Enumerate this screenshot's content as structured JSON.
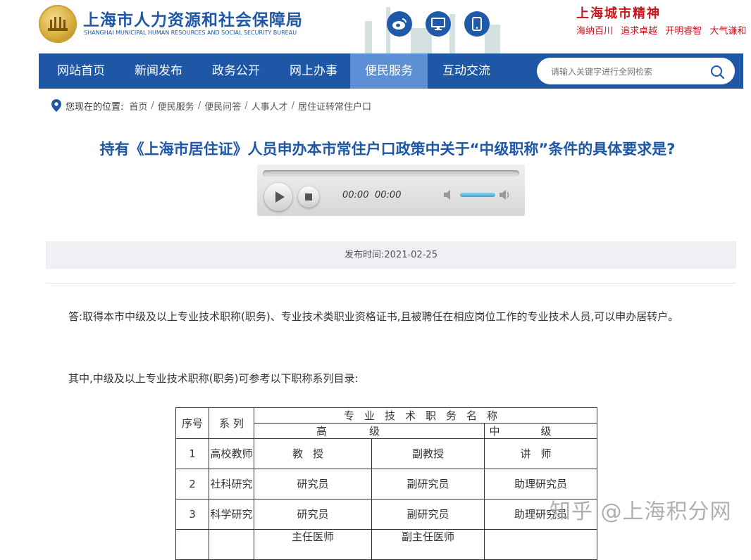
{
  "header": {
    "org_name_cn": "上海市人力资源和社会保障局",
    "org_name_en": "SHANGHAI MUNICIPAL HUMAN RESOURCES AND SOCIAL SECURITY BUREAU",
    "icons": [
      "weibo-icon",
      "desktop-icon",
      "mobile-icon"
    ],
    "slogan_title": "上海城市精神",
    "slogan_items": [
      "海纳百川",
      "追求卓越",
      "开明睿智",
      "大气谦和"
    ]
  },
  "nav": {
    "items": [
      "网站首页",
      "新闻发布",
      "政务公开",
      "网上办事",
      "便民服务",
      "互动交流"
    ],
    "active": "便民服务",
    "search_placeholder": "请输入关键字进行全网检索"
  },
  "breadcrumb": {
    "label": "您现在的位置:",
    "items": [
      "首页",
      "便民服务",
      "便民问答",
      "人事人才",
      "居住证转常住户口"
    ]
  },
  "article": {
    "title": "持有《上海市居住证》人员申办本市常住户口政策中关于“中级职称”条件的具体要求是?",
    "player": {
      "current_time": "00:00",
      "duration": "00:00"
    },
    "publish_date": "发布时间:2021-02-25",
    "paragraphs": [
      "答:取得本市中级及以上专业技术职称(职务)、专业技术类职业资格证书,且被聘任在相应岗位工作的专业技术人员,可以申办居转户。",
      "其中,中级及以上专业技术职称(职务)可参考以下职称系列目录:"
    ]
  },
  "table": {
    "headers": {
      "seq": "序号",
      "series": "系 列",
      "title_group": "专业技术职务名称",
      "senior": "高级",
      "middle": "中级"
    },
    "rows": [
      {
        "seq": "1",
        "series": "高校教师",
        "full": "教授",
        "deputy": "副教授",
        "mid": "讲师"
      },
      {
        "seq": "2",
        "series": "社科研究",
        "full": "研究员",
        "deputy": "副研究员",
        "mid": "助理研究员"
      },
      {
        "seq": "3",
        "series": "科学研究",
        "full": "研究员",
        "deputy": "副研究员",
        "mid": "助理研究员"
      },
      {
        "seq": "",
        "series": "",
        "full": "主任医师",
        "deputy": "副主任医师",
        "mid": ""
      }
    ]
  },
  "watermark": "知乎 @上海积分网"
}
